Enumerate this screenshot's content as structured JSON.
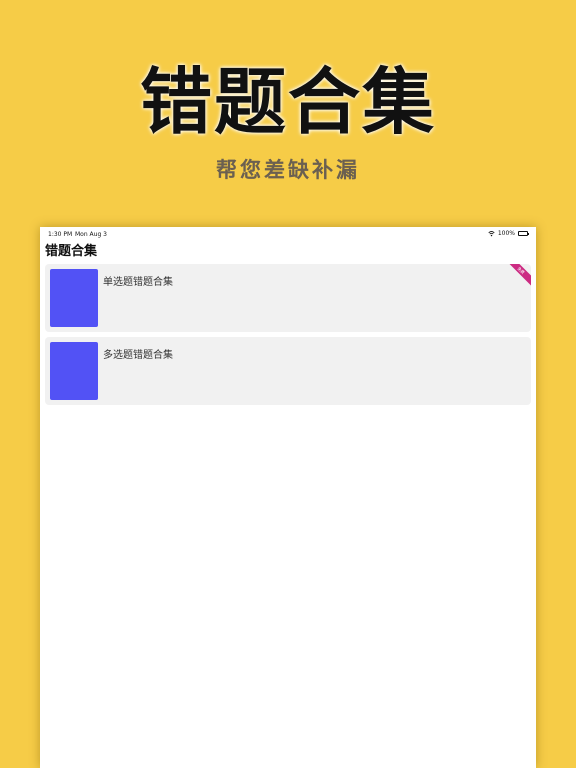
{
  "promo": {
    "headline": "错题合集",
    "subline": "帮您差缺补漏"
  },
  "status_bar": {
    "time": "1:30 PM",
    "date": "Mon Aug 3",
    "battery": "100%"
  },
  "nav": {
    "title": "错题合集"
  },
  "list": {
    "items": [
      {
        "label": "单选题错题合集",
        "badge": "免费"
      },
      {
        "label": "多选题错题合集"
      }
    ]
  },
  "colors": {
    "background": "#f6cc47",
    "card": "#f1f1f1",
    "thumbnail": "#5252f5",
    "ribbon": "#cc2b82"
  }
}
